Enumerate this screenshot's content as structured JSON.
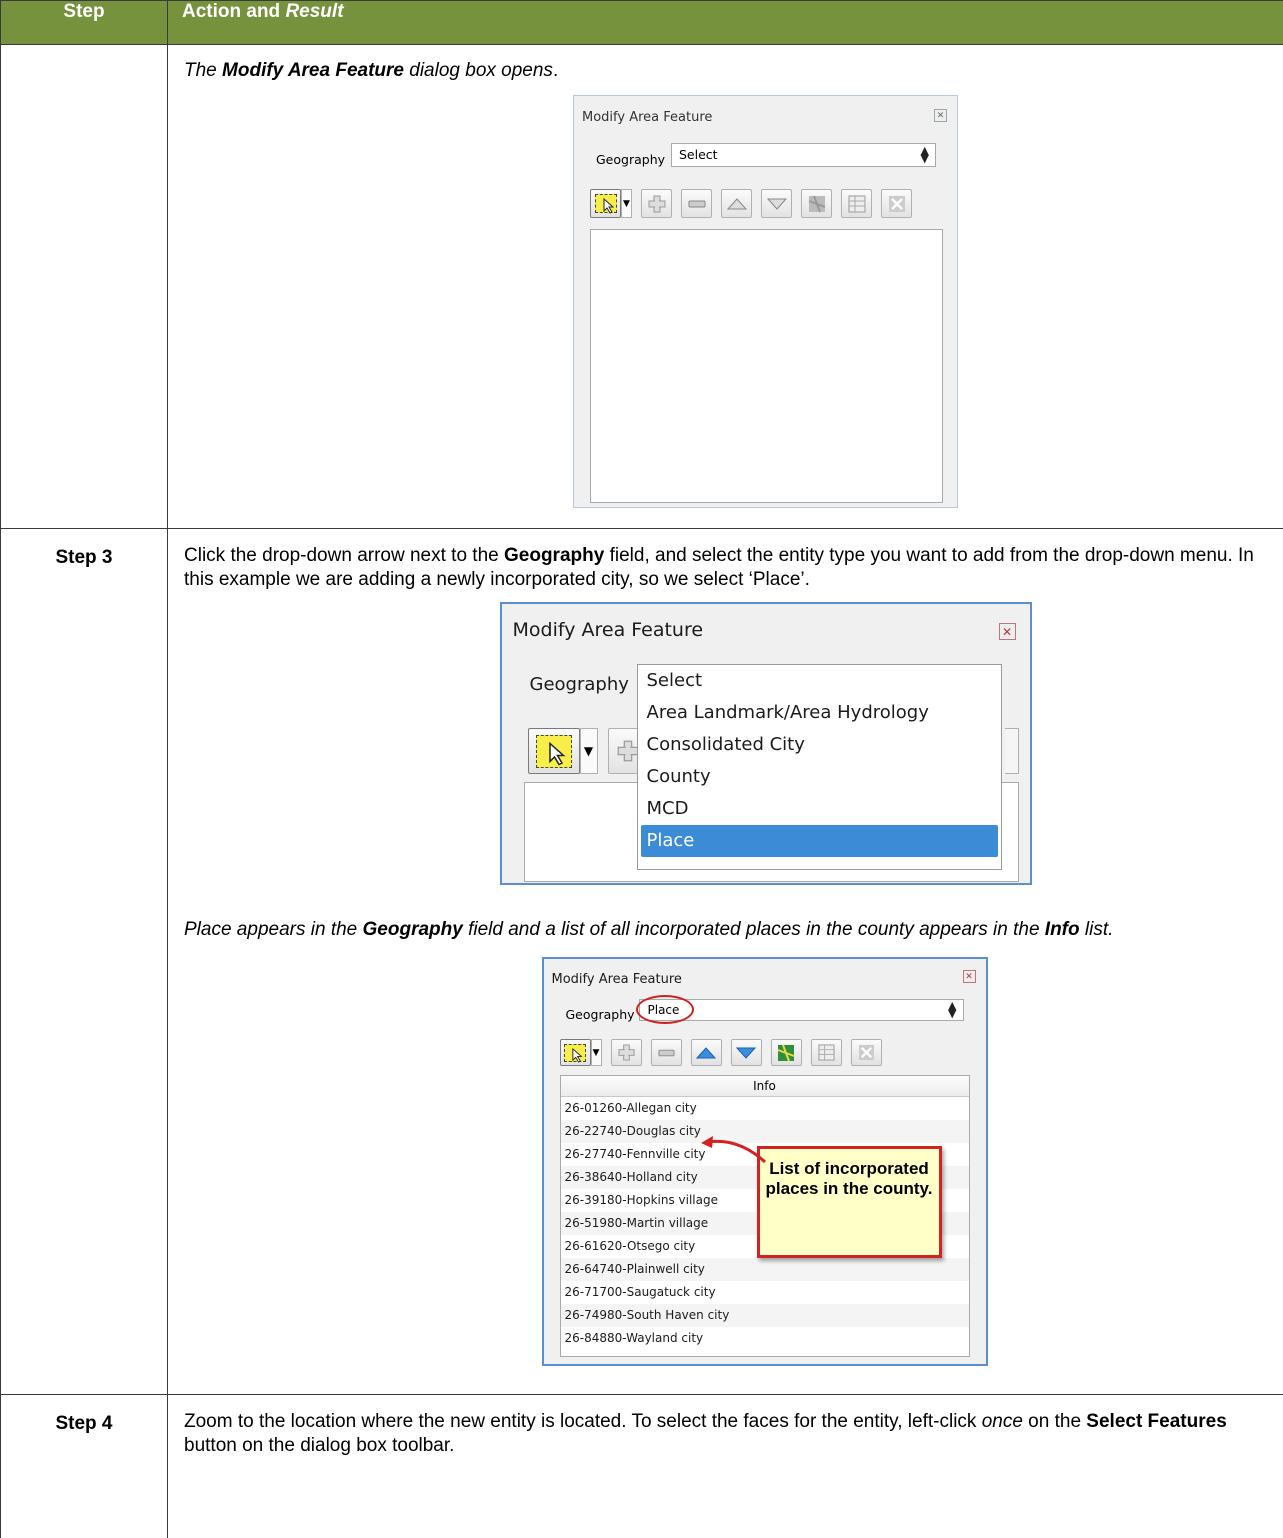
{
  "table": {
    "header_step": "Step",
    "header_action": "Action and",
    "header_result": "Result"
  },
  "row1": {
    "result_pre": "The ",
    "result_bold": "Modify Area Feature",
    "result_post": " dialog box opens",
    "result_end": "."
  },
  "dialog1": {
    "title": "Modify Area Feature",
    "geography_label": "Geography",
    "geography_value": "Select"
  },
  "row3": {
    "step": "Step 3",
    "text1": "Click the drop-down arrow next to the ",
    "text1_bold": "Geography",
    "text1_rest": " field, and select the entity type you want to add from the drop-down menu. In this example we are adding a newly incorporated city, so we select ‘Place’.",
    "result2_a": "Place appears in the ",
    "result2_b": "Geography",
    "result2_c": " field and a list of all incorporated places in the county appears in the ",
    "result2_d": "Info",
    "result2_e": " list."
  },
  "dialog2": {
    "title": "Modify Area Feature",
    "geography_label": "Geography",
    "options": [
      "Select",
      "Area Landmark/Area Hydrology",
      "Consolidated City",
      "County",
      "MCD",
      "Place"
    ],
    "highlighted": "Place"
  },
  "dialog3": {
    "title": "Modify Area Feature",
    "geography_label": "Geography",
    "geography_value": "Place",
    "info_header": "Info",
    "items": [
      "26-01260-Allegan city",
      "26-22740-Douglas city",
      "26-27740-Fennville city",
      "26-38640-Holland city",
      "26-39180-Hopkins village",
      "26-51980-Martin village",
      "26-61620-Otsego city",
      "26-64740-Plainwell city",
      "26-71700-Saugatuck city",
      "26-74980-South Haven city",
      "26-84880-Wayland city"
    ],
    "callout": "List of incorporated places in the county."
  },
  "row4": {
    "step": "Step 4",
    "text_a": "Zoom to the location where the new entity is located. To select the faces for the entity, left-click ",
    "text_b": "once",
    "text_c": " on the ",
    "text_d": "Select Features",
    "text_e": " button on the dialog box toolbar."
  },
  "colors": {
    "header_bg": "#76923c",
    "highlight": "#3c8bd6",
    "callout_border": "#d42222",
    "callout_bg": "#ffffc8"
  },
  "icons": [
    "select-features-icon",
    "dropdown-arrow-icon",
    "add-icon",
    "remove-icon",
    "move-up-icon",
    "move-down-icon",
    "map-icon",
    "table-icon",
    "clear-icon",
    "close-icon"
  ]
}
